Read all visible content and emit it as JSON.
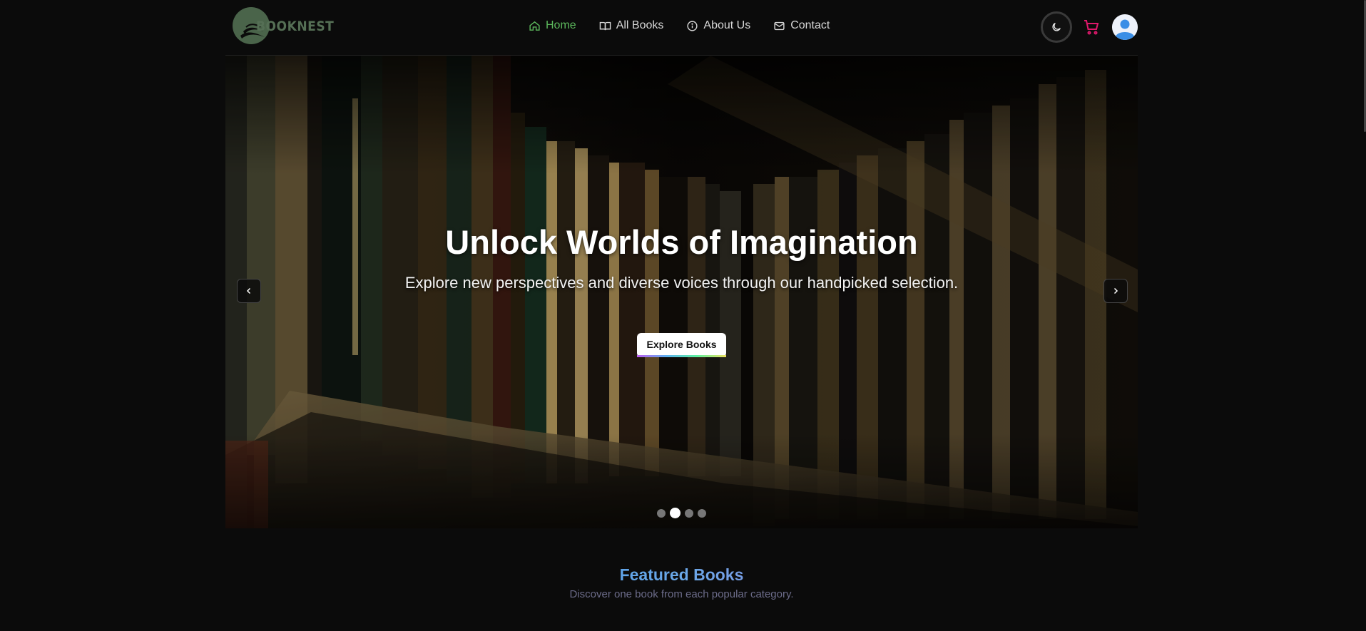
{
  "brand": {
    "name": "BOOKNEST",
    "color": "#556f55"
  },
  "nav": {
    "links": [
      {
        "label": "Home",
        "icon": "home-icon",
        "active": true
      },
      {
        "label": "All Books",
        "icon": "book-icon",
        "active": false
      },
      {
        "label": "About Us",
        "icon": "info-icon",
        "active": false
      },
      {
        "label": "Contact",
        "icon": "mail-icon",
        "active": false
      }
    ],
    "active_color": "#5cb85c"
  },
  "actions": {
    "theme_icon": "moon-icon",
    "cart_icon": "cart-icon",
    "cart_color": "#e0186c",
    "avatar_icon": "user-avatar-icon"
  },
  "hero": {
    "title": "Unlock Worlds of Imagination",
    "subtitle": "Explore new perspectives and diverse voices through our handpicked selection.",
    "cta_label": "Explore Books",
    "slide_count": 4,
    "active_slide": 2
  },
  "featured": {
    "title": "Featured Books",
    "subtitle": "Discover one book from each popular category."
  }
}
